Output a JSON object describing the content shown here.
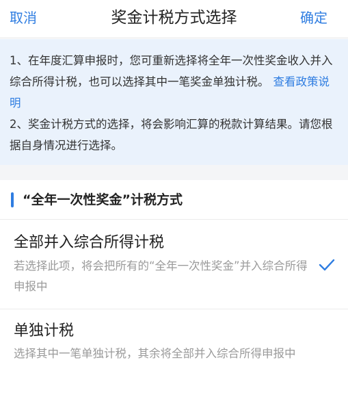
{
  "navbar": {
    "cancel_label": "取消",
    "title": "奖金计税方式选择",
    "confirm_label": "确定"
  },
  "notice": {
    "line1": "1、在年度汇算申报时，您可重新选择将全年一次性奖金收入并入综合所得计税，也可以选择其中一笔奖金单独计税。",
    "policy_link": "查看政策说明",
    "line2": "2、奖金计税方式的选择，将会影响汇算的税款计算结果。请您根据自身情况进行选择。"
  },
  "section": {
    "title": "“全年一次性奖金”计税方式"
  },
  "options": [
    {
      "title": "全部并入综合所得计税",
      "description": "若选择此项，将会把所有的“全年一次性奖金”并入综合所得申报中",
      "selected": true
    },
    {
      "title": "单独计税",
      "description": "选择其中一笔单独计税，其余将全部并入综合所得申报中",
      "selected": false
    }
  ],
  "colors": {
    "accent": "#2f7de1",
    "notice_background": "#eaf2fc"
  },
  "icons": {
    "selected": "check-icon"
  }
}
